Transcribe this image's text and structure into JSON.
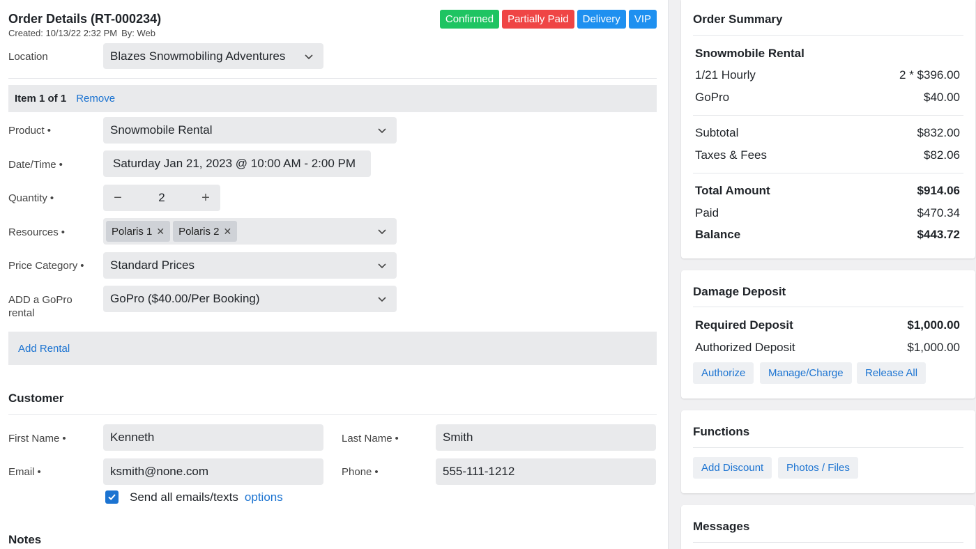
{
  "order": {
    "title": "Order Details (RT-000234)",
    "created": "Created: 10/13/22 2:32 PM",
    "by": "By: Web",
    "badges": [
      "Confirmed",
      "Partially Paid",
      "Delivery",
      "VIP"
    ],
    "badge_colors": [
      "#1ec462",
      "#ef4545",
      "#1e90f0",
      "#1e90f0"
    ]
  },
  "location": {
    "label": "Location",
    "value": "Blazes Snowmobiling Adventures"
  },
  "item": {
    "counter": "Item 1 of 1",
    "remove": "Remove"
  },
  "form": {
    "product_label": "Product",
    "product_value": "Snowmobile Rental",
    "datetime_label": "Date/Time",
    "datetime_value": "Saturday Jan 21, 2023 @ 10:00 AM - 2:00 PM",
    "quantity_label": "Quantity",
    "quantity_value": "2",
    "minus": "−",
    "plus": "+",
    "resources_label": "Resources",
    "resources": [
      "Polaris 1",
      "Polaris 2"
    ],
    "price_category_label": "Price Category",
    "price_category_value": "Standard Prices",
    "gopro_label_1": "ADD a GoPro",
    "gopro_label_2": "rental",
    "gopro_value": "GoPro ($40.00/Per Booking)",
    "required_marker": "•",
    "add_rental": "Add Rental"
  },
  "customer": {
    "section": "Customer",
    "first_name_label": "First Name",
    "first_name": "Kenneth",
    "last_name_label": "Last Name",
    "last_name": "Smith",
    "email_label": "Email",
    "email": "ksmith@none.com",
    "phone_label": "Phone",
    "phone": "555-111-1212",
    "send_all": "Send all emails/texts",
    "options": "options"
  },
  "notes": {
    "section": "Notes"
  },
  "summary": {
    "title": "Order Summary",
    "product": "Snowmobile Rental",
    "lines": [
      {
        "label": "1/21 Hourly",
        "value": "2 * $396.00"
      },
      {
        "label": "GoPro",
        "value": "$40.00"
      }
    ],
    "subtotal_label": "Subtotal",
    "subtotal": "$832.00",
    "taxes_label": "Taxes & Fees",
    "taxes": "$82.06",
    "total_label": "Total Amount",
    "total": "$914.06",
    "paid_label": "Paid",
    "paid": "$470.34",
    "balance_label": "Balance",
    "balance": "$443.72"
  },
  "deposit": {
    "title": "Damage Deposit",
    "required_label": "Required Deposit",
    "required": "$1,000.00",
    "authorized_label": "Authorized Deposit",
    "authorized": "$1,000.00",
    "buttons": [
      "Authorize",
      "Manage/Charge",
      "Release All"
    ]
  },
  "functions": {
    "title": "Functions",
    "buttons": [
      "Add Discount",
      "Photos / Files"
    ]
  },
  "messages": {
    "title": "Messages"
  }
}
